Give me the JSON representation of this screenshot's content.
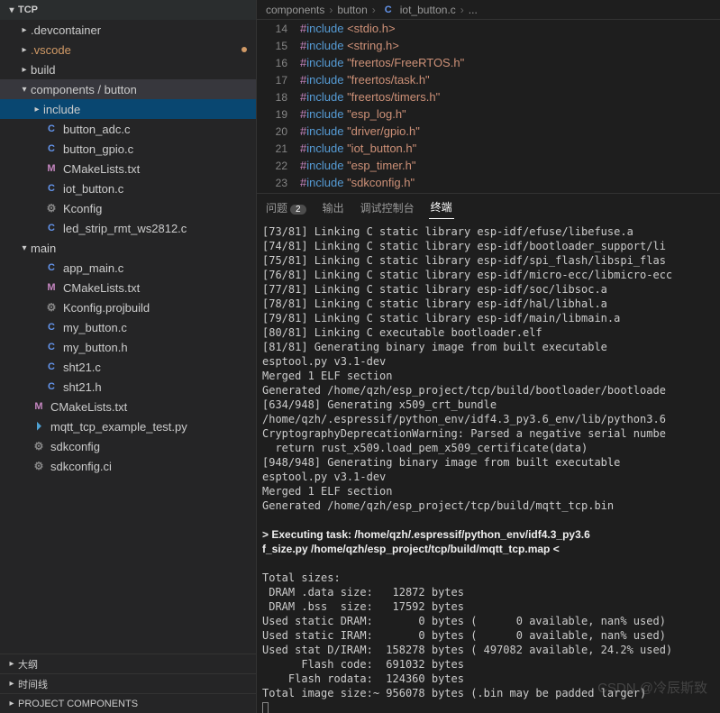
{
  "explorer": {
    "root": "TCP",
    "items": [
      {
        "indent": 0,
        "chev": "▾",
        "label": "TCP",
        "bold": true
      },
      {
        "indent": 1,
        "chev": "▸",
        "label": ".devcontainer"
      },
      {
        "indent": 1,
        "chev": "▸",
        "label": ".vscode",
        "orange": true,
        "dot": true
      },
      {
        "indent": 1,
        "chev": "▸",
        "label": "build"
      },
      {
        "indent": 1,
        "chev": "▾",
        "label": "components / button",
        "selected": true
      },
      {
        "indent": 2,
        "chev": "▸",
        "label": "include",
        "active": true
      },
      {
        "indent": 2,
        "ico": "C",
        "label": "button_adc.c"
      },
      {
        "indent": 2,
        "ico": "C",
        "label": "button_gpio.c"
      },
      {
        "indent": 2,
        "ico": "M",
        "label": "CMakeLists.txt"
      },
      {
        "indent": 2,
        "ico": "C",
        "label": "iot_button.c"
      },
      {
        "indent": 2,
        "ico": "gear",
        "label": "Kconfig"
      },
      {
        "indent": 2,
        "ico": "C",
        "label": "led_strip_rmt_ws2812.c"
      },
      {
        "indent": 1,
        "chev": "▾",
        "label": "main"
      },
      {
        "indent": 2,
        "ico": "C",
        "label": "app_main.c"
      },
      {
        "indent": 2,
        "ico": "M",
        "label": "CMakeLists.txt"
      },
      {
        "indent": 2,
        "ico": "gear",
        "label": "Kconfig.projbuild"
      },
      {
        "indent": 2,
        "ico": "C",
        "label": "my_button.c"
      },
      {
        "indent": 2,
        "ico": "C",
        "label": "my_button.h"
      },
      {
        "indent": 2,
        "ico": "C",
        "label": "sht21.c"
      },
      {
        "indent": 2,
        "ico": "C",
        "label": "sht21.h"
      },
      {
        "indent": 1,
        "ico": "M",
        "label": "CMakeLists.txt"
      },
      {
        "indent": 1,
        "ico": "py",
        "label": "mqtt_tcp_example_test.py"
      },
      {
        "indent": 1,
        "ico": "gear",
        "label": "sdkconfig"
      },
      {
        "indent": 1,
        "ico": "gear",
        "label": "sdkconfig.ci"
      }
    ],
    "bottom": [
      "大纲",
      "时间线",
      "PROJECT COMPONENTS"
    ]
  },
  "breadcrumbs": [
    "components",
    "button",
    "iot_button.c",
    "..."
  ],
  "code": [
    {
      "n": 14,
      "inc": "<stdio.h>"
    },
    {
      "n": 15,
      "inc": "<string.h>"
    },
    {
      "n": 16,
      "inc": "\"freertos/FreeRTOS.h\""
    },
    {
      "n": 17,
      "inc": "\"freertos/task.h\""
    },
    {
      "n": 18,
      "inc": "\"freertos/timers.h\""
    },
    {
      "n": 19,
      "inc": "\"esp_log.h\""
    },
    {
      "n": 20,
      "inc": "\"driver/gpio.h\""
    },
    {
      "n": 21,
      "inc": "\"iot_button.h\""
    },
    {
      "n": 22,
      "inc": "\"esp_timer.h\""
    },
    {
      "n": 23,
      "inc": "\"sdkconfig.h\""
    }
  ],
  "code_word": {
    "hash": "#",
    "include": "include"
  },
  "icons": {
    "C": "C",
    "M": "M",
    "gear": "⚙",
    "py": "⏵",
    "chev": "▸"
  },
  "tabs": {
    "problems": "问题",
    "count": "2",
    "output": "输出",
    "debug": "调试控制台",
    "terminal": "终端"
  },
  "terminal_lines": [
    "[73/81] Linking C static library esp-idf/efuse/libefuse.a",
    "[74/81] Linking C static library esp-idf/bootloader_support/li",
    "[75/81] Linking C static library esp-idf/spi_flash/libspi_flas",
    "[76/81] Linking C static library esp-idf/micro-ecc/libmicro-ecc",
    "[77/81] Linking C static library esp-idf/soc/libsoc.a",
    "[78/81] Linking C static library esp-idf/hal/libhal.a",
    "[79/81] Linking C static library esp-idf/main/libmain.a",
    "[80/81] Linking C executable bootloader.elf",
    "[81/81] Generating binary image from built executable",
    "esptool.py v3.1-dev",
    "Merged 1 ELF section",
    "Generated /home/qzh/esp_project/tcp/build/bootloader/bootloade",
    "[634/948] Generating x509_crt_bundle",
    "/home/qzh/.espressif/python_env/idf4.3_py3.6_env/lib/python3.6",
    "CryptographyDeprecationWarning: Parsed a negative serial numbe",
    "  return rust_x509.load_pem_x509_certificate(data)",
    "[948/948] Generating binary image from built executable",
    "esptool.py v3.1-dev",
    "Merged 1 ELF section",
    "Generated /home/qzh/esp_project/tcp/build/mqtt_tcp.bin",
    ""
  ],
  "terminal_bold": [
    "> Executing task: /home/qzh/.espressif/python_env/idf4.3_py3.6",
    "f_size.py /home/qzh/esp_project/tcp/build/mqtt_tcp.map <"
  ],
  "terminal_sizes": [
    "",
    "Total sizes:",
    " DRAM .data size:   12872 bytes",
    " DRAM .bss  size:   17592 bytes",
    "Used static DRAM:       0 bytes (      0 available, nan% used)",
    "Used static IRAM:       0 bytes (      0 available, nan% used)",
    "Used stat D/IRAM:  158278 bytes ( 497082 available, 24.2% used)",
    "      Flash code:  691032 bytes",
    "    Flash rodata:  124360 bytes",
    "Total image size:~ 956078 bytes (.bin may be padded larger)"
  ],
  "watermark": "CSDN @冷辰斯致"
}
